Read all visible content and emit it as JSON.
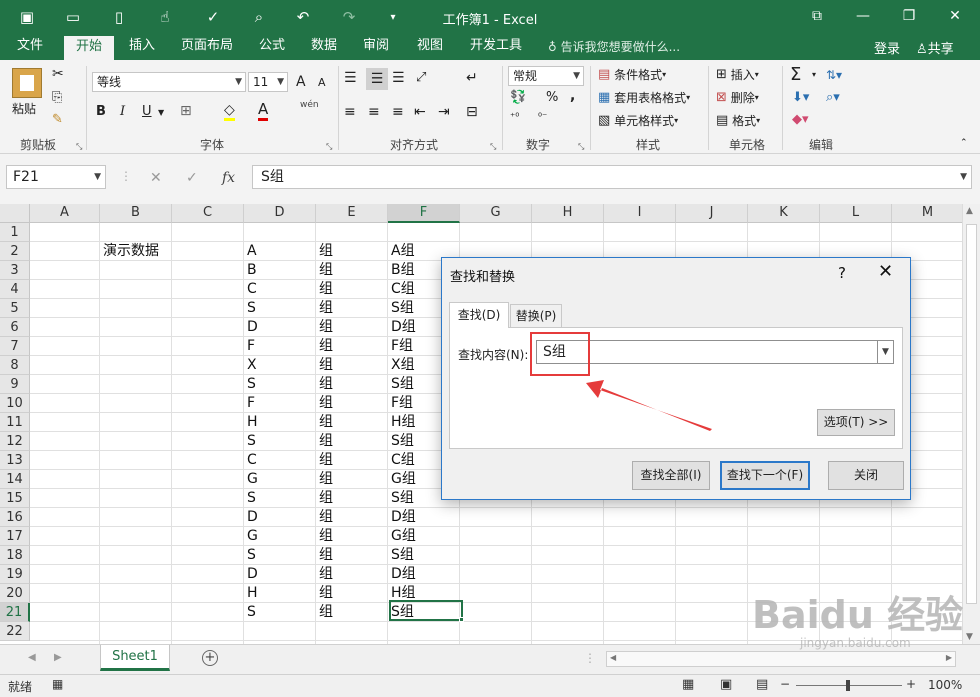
{
  "window": {
    "title": "工作簿1 - Excel",
    "minimize": "—",
    "restore": "❐",
    "close": "✕",
    "ribbon_display": "⧉"
  },
  "quick_access": [
    "save-icon",
    "open-icon",
    "new-icon",
    "touch-icon",
    "spell-icon",
    "preview-icon",
    "undo-icon",
    "redo-icon",
    "customize-icon"
  ],
  "tabs": [
    "文件",
    "开始",
    "插入",
    "页面布局",
    "公式",
    "数据",
    "审阅",
    "视图",
    "开发工具"
  ],
  "active_tab": "开始",
  "tell_me": "告诉我您想要做什么...",
  "login": "登录",
  "share": "共享",
  "ribbon": {
    "clipboard": {
      "label": "剪贴板",
      "paste": "粘贴"
    },
    "font": {
      "label": "字体",
      "family": "等线",
      "size": "11",
      "bold": "B",
      "italic": "I",
      "underline": "U",
      "grow": "A",
      "shrink": "A",
      "wen": "wén",
      "font_color": "A",
      "fill": "◇"
    },
    "alignment": {
      "label": "对齐方式"
    },
    "number": {
      "label": "数字",
      "format": "常规",
      "percent": "%",
      "comma": ","
    },
    "styles": {
      "label": "样式",
      "conditional": "条件格式",
      "table": "套用表格格式",
      "cell": "单元格样式"
    },
    "cells": {
      "label": "单元格",
      "insert": "插入",
      "delete": "删除",
      "format": "格式"
    },
    "editing": {
      "label": "编辑",
      "sum": "Σ"
    }
  },
  "formula_bar": {
    "name_box": "F21",
    "value": "S组",
    "fx": "fx",
    "cancel": "✕",
    "enter": "✓"
  },
  "columns": [
    "A",
    "B",
    "C",
    "D",
    "E",
    "F",
    "G",
    "H",
    "I",
    "J",
    "K",
    "L",
    "M"
  ],
  "selected_column": "F",
  "rows": [
    "1",
    "2",
    "3",
    "4",
    "5",
    "6",
    "7",
    "8",
    "9",
    "10",
    "11",
    "12",
    "13",
    "14",
    "15",
    "16",
    "17",
    "18",
    "19",
    "20",
    "21",
    "22"
  ],
  "selected_row": "21",
  "cells": {
    "B2": "演示数据",
    "D": [
      "A",
      "B",
      "C",
      "S",
      "D",
      "F",
      "X",
      "S",
      "F",
      "H",
      "S",
      "C",
      "G",
      "S",
      "D",
      "G",
      "S",
      "D",
      "H",
      "S"
    ],
    "E": [
      "组",
      "组",
      "组",
      "组",
      "组",
      "组",
      "组",
      "组",
      "组",
      "组",
      "组",
      "组",
      "组",
      "组",
      "组",
      "组",
      "组",
      "组",
      "组",
      "组"
    ],
    "F": [
      "A组",
      "B组",
      "C组",
      "S组",
      "D组",
      "F组",
      "X组",
      "S组",
      "F组",
      "H组",
      "S组",
      "C组",
      "G组",
      "S组",
      "D组",
      "G组",
      "S组",
      "D组",
      "H组",
      "S组"
    ]
  },
  "sheet_tab": "Sheet1",
  "add_sheet": "+",
  "status": {
    "ready": "就绪",
    "zoom": "100%",
    "minus": "−",
    "plus": "+"
  },
  "dialog": {
    "title": "查找和替换",
    "help": "?",
    "close": "✕",
    "tab_find": "查找(D)",
    "tab_replace": "替换(P)",
    "find_label": "查找内容(N):",
    "find_value": "S组",
    "options": "选项(T) >>",
    "find_all": "查找全部(I)",
    "find_next": "查找下一个(F)",
    "close_btn": "关闭"
  },
  "watermark": {
    "text": "Baidu 经验",
    "sub": "jingyan.baidu.com"
  },
  "colors": {
    "excel_green": "#217346",
    "highlight_red": "#e53b3b",
    "dialog_border": "#2b78c9"
  }
}
